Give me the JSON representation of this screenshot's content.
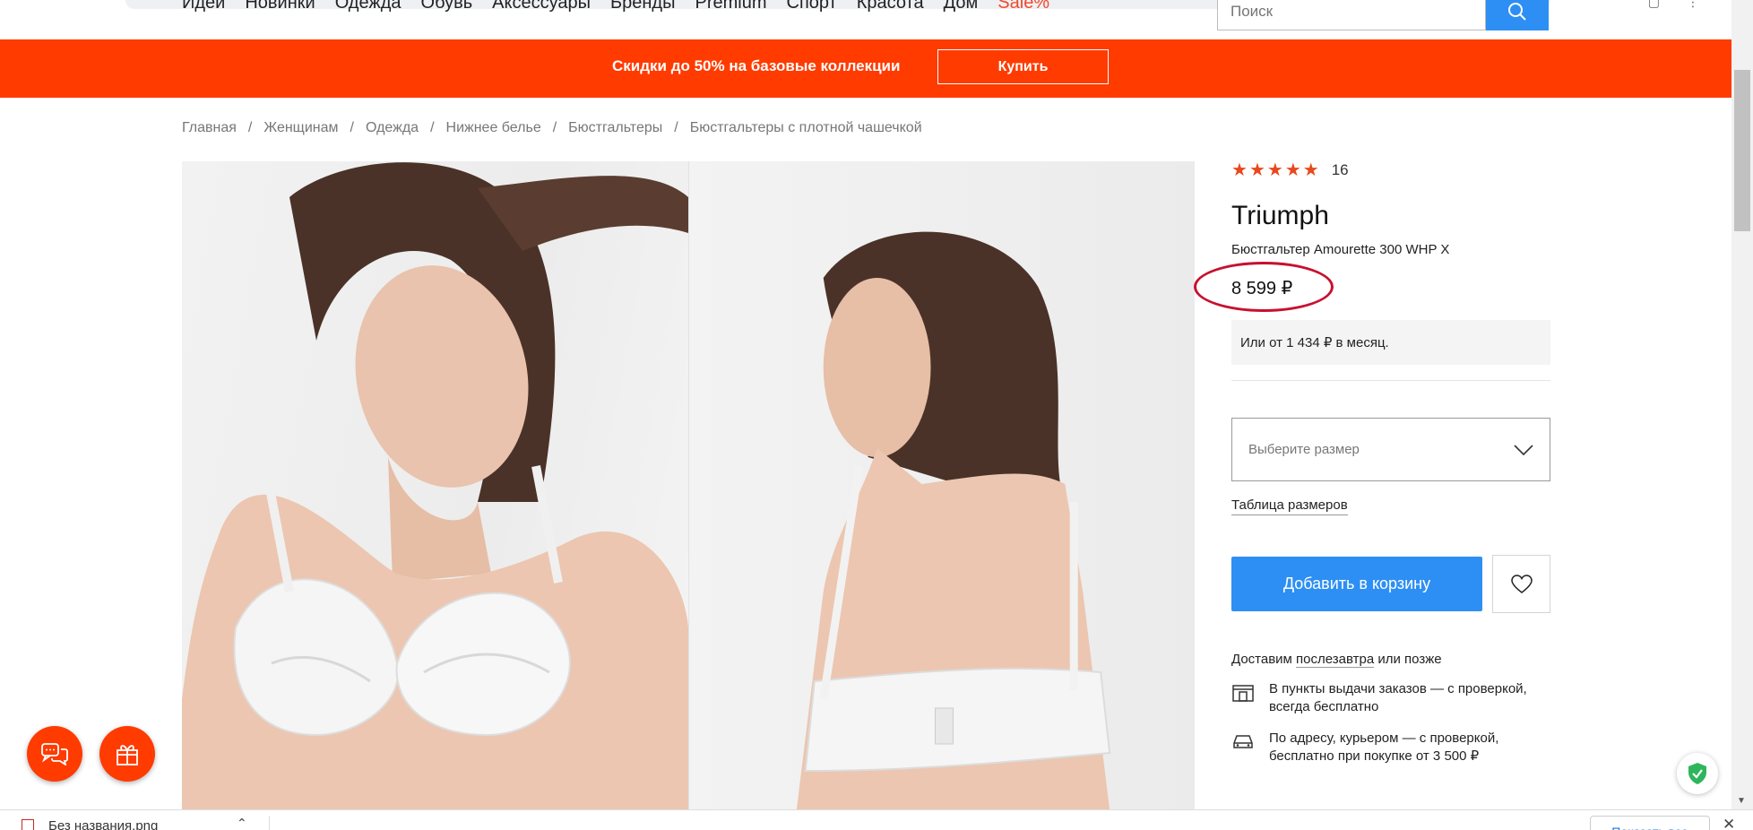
{
  "nav": {
    "items": [
      "Идеи",
      "Новинки",
      "Одежда",
      "Обувь",
      "Аксессуары",
      "Бренды",
      "Premium",
      "Спорт",
      "Красота",
      "Дом"
    ],
    "sale": "Sale%",
    "search_placeholder": "Поиск"
  },
  "promo": {
    "text": "Скидки до 50% на базовые коллекции",
    "button": "Купить",
    "color": "#ff3b00"
  },
  "breadcrumb": [
    "Главная",
    "Женщинам",
    "Одежда",
    "Нижнее белье",
    "Бюстгальтеры",
    "Бюстгальтеры с плотной чашечкой"
  ],
  "product": {
    "rating_stars": 5,
    "review_count": "16",
    "brand": "Triumph",
    "model": "Бюстгальтер Amourette 300 WHP X",
    "price": "8 599 ₽",
    "installment": "Или от 1 434 ₽ в месяц.",
    "size_placeholder": "Выберите размер",
    "size_table_link": "Таблица размеров",
    "add_to_cart": "Добавить в корзину"
  },
  "delivery": {
    "prefix": "Доставим",
    "when": "послезавтра",
    "suffix": "или позже",
    "options": [
      {
        "icon": "pickup-point-icon",
        "text": "В пункты выдачи заказов — с проверкой, всегда бесплатно"
      },
      {
        "icon": "courier-car-icon",
        "text": "По адресу, курьером — с проверкой, бесплатно при покупке от 3 500 ₽"
      }
    ]
  },
  "download_bar": {
    "file_name": "Без названия.png",
    "show_all": "Показать все"
  },
  "colors": {
    "accent_blue": "#2d8ff3",
    "brand_orange": "#ff3b00",
    "star": "#e8481c",
    "annotation_red": "#c8102e"
  }
}
